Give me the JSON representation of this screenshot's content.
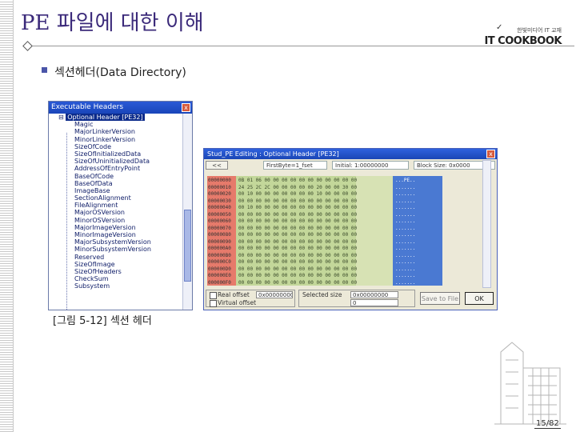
{
  "slide": {
    "title": "PE 파일에 대한 이해",
    "bullet": "섹션헤더(Data Directory)",
    "caption": "[그림 5-12] 섹션 헤더",
    "page_number": "15/82"
  },
  "logo": {
    "top_text": "한빛미디어 IT 교재",
    "brand": "IT COOKBOOK"
  },
  "executable_headers": {
    "title": "Executable Headers",
    "close_label": "x",
    "root_item": "Optional Header [PE32]",
    "items": [
      "Magic",
      "MajorLinkerVersion",
      "MinorLinkerVersion",
      "SizeOfCode",
      "SizeOfInitializedData",
      "SizeOfUninitializedData",
      "AddressOfEntryPoint",
      "BaseOfCode",
      "BaseOfData",
      "ImageBase",
      "SectionAlignment",
      "FileAlignment",
      "MajorOSVersion",
      "MinorOSVersion",
      "MajorImageVersion",
      "MinorImageVersion",
      "MajorSubsystemVersion",
      "MinorSubsystemVersion",
      "Reserved",
      "SizeOfImage",
      "SizeOfHeaders",
      "CheckSum",
      "Subsystem"
    ]
  },
  "optional_header_editor": {
    "title": "Stud_PE Editing : Optional Header [PE32]",
    "close_label": "x",
    "toolbar": {
      "nav_label": "<<",
      "offset_field": "FirstByte=1_fset",
      "middle_field": "Initial: 1:00000000",
      "size_field": "Block Size: 0x0000"
    },
    "hex_rows": [
      {
        "offset": "00000000",
        "hex": "0B 01 06 00 00 00 00 00 00 00 00 00 00 00",
        "ascii": "...PE.."
      },
      {
        "offset": "00000010",
        "hex": "24 25 2C 2C 00 00 00 00 00 20 00 00 30 00",
        "ascii": "......."
      },
      {
        "offset": "00000020",
        "hex": "00 10 00 00 00 00 00 00 00 10 00 00 00 00",
        "ascii": "......."
      },
      {
        "offset": "00000030",
        "hex": "00 00 00 00 00 00 00 00 00 00 00 00 00 00",
        "ascii": "......."
      },
      {
        "offset": "00000040",
        "hex": "00 10 00 00 00 00 00 00 00 00 00 00 00 00",
        "ascii": "......."
      },
      {
        "offset": "00000050",
        "hex": "00 00 00 00 00 00 00 00 00 00 00 00 00 00",
        "ascii": "......."
      },
      {
        "offset": "00000060",
        "hex": "00 00 00 00 00 00 00 00 00 00 00 00 00 00",
        "ascii": "......."
      },
      {
        "offset": "00000070",
        "hex": "00 00 00 00 00 00 00 00 00 00 00 00 00 00",
        "ascii": "......."
      },
      {
        "offset": "00000080",
        "hex": "00 00 00 00 00 00 00 00 00 00 00 00 00 00",
        "ascii": "......."
      },
      {
        "offset": "00000090",
        "hex": "00 00 00 00 00 00 00 00 00 00 00 00 00 00",
        "ascii": "......."
      },
      {
        "offset": "000000A0",
        "hex": "00 00 00 00 00 00 00 00 00 00 00 00 00 00",
        "ascii": "......."
      },
      {
        "offset": "000000B0",
        "hex": "00 00 00 00 00 00 00 00 00 00 00 00 00 00",
        "ascii": "......."
      },
      {
        "offset": "000000C0",
        "hex": "00 00 00 00 00 00 00 00 00 00 00 00 00 00",
        "ascii": "......."
      },
      {
        "offset": "000000D0",
        "hex": "00 00 00 00 00 00 00 00 00 00 00 00 00 00",
        "ascii": "......."
      },
      {
        "offset": "000000E0",
        "hex": "00 00 00 00 00 00 00 00 00 00 00 00 00 00",
        "ascii": "......."
      },
      {
        "offset": "000000F0",
        "hex": "00 00 00 00 00 00 00 00 00 00 00 00 00 00",
        "ascii": "......."
      }
    ],
    "status": {
      "check1_label": "Real offset",
      "check1_value": "0x00000000",
      "check2_label": "Virtual offset",
      "selected_label": "Selected size",
      "selected_value": "0x00000000",
      "virtual_value": "0",
      "save_button": "Save to File",
      "ok_button": "OK"
    }
  },
  "colors": {
    "title": "#3b2a7a",
    "offset_column": "#e67a6b",
    "hex_column": "#c3d79a",
    "ascii_column": "#4a79d2",
    "titlebar": "#1a46b5"
  }
}
